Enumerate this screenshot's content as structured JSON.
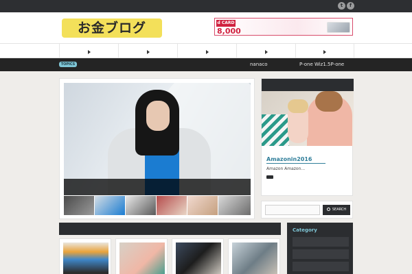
{
  "topbar": {
    "social": [
      {
        "name": "twitter-icon",
        "glyph": "t"
      },
      {
        "name": "facebook-icon",
        "glyph": "f"
      }
    ]
  },
  "header": {
    "logo_text": "お金ブログ",
    "banner": {
      "brand": "d CARD",
      "amount": "8,000"
    }
  },
  "nav": {
    "items": [
      {
        "label": ""
      },
      {
        "label": ""
      },
      {
        "label": ""
      },
      {
        "label": ""
      },
      {
        "label": ""
      }
    ]
  },
  "ticker": {
    "badge": "TOPICS",
    "items": [
      "nanaco",
      "P-one Wiz1.5P-one"
    ]
  },
  "sidebar": {
    "featured": {
      "title": "Amazonin2016",
      "excerpt": "Amazon Amazon..."
    },
    "search": {
      "placeholder": "",
      "button_label": "SEARCH"
    },
    "category": {
      "title": "Category"
    }
  },
  "colors": {
    "accent": "#7fc6d6",
    "dark": "#2b2d30",
    "link": "#2e7d99"
  }
}
